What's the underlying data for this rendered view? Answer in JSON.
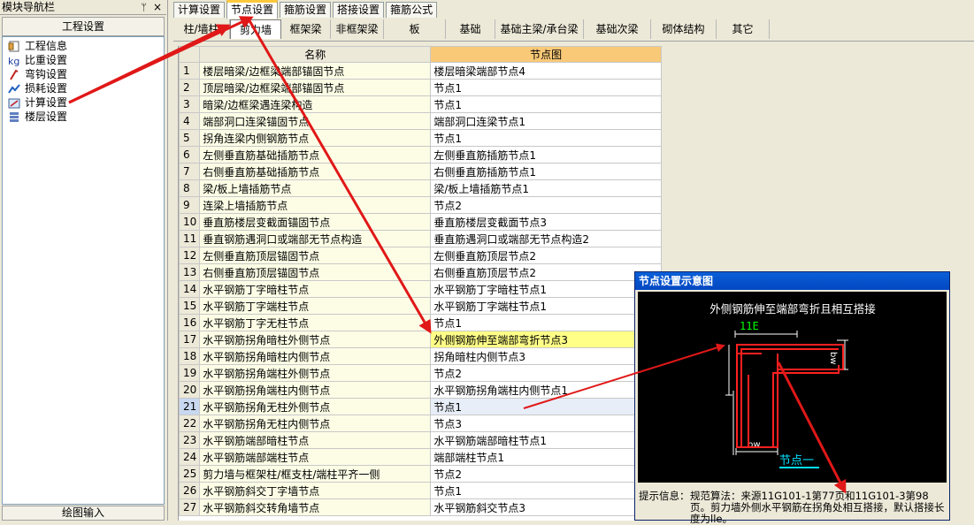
{
  "nav": {
    "title": "模块导航栏",
    "pin": "ᛘ",
    "close": "×",
    "section": "工程设置",
    "items": [
      {
        "label": "工程信息",
        "icon": "document-icon"
      },
      {
        "label": "比重设置",
        "icon": "scale-icon"
      },
      {
        "label": "弯钩设置",
        "icon": "hook-icon"
      },
      {
        "label": "损耗设置",
        "icon": "chart-icon"
      },
      {
        "label": "计算设置",
        "icon": "calc-settings-icon"
      },
      {
        "label": "楼层设置",
        "icon": "floors-icon"
      }
    ],
    "bottom": "绘图输入"
  },
  "tabs": [
    "计算设置",
    "节点设置",
    "箍筋设置",
    "搭接设置",
    "箍筋公式"
  ],
  "active_tab": 1,
  "subtabs": [
    "柱/墙柱",
    "剪力墙",
    "框架梁",
    "非框架梁",
    "板",
    "基础",
    "基础主梁/承台梁",
    "基础次梁",
    "砌体结构",
    "其它"
  ],
  "active_subtab": 1,
  "table": {
    "headers": {
      "name": "名称",
      "detail": "节点图"
    },
    "rows": [
      {
        "n": "1",
        "name": "楼层暗梁/边框梁端部锚固节点",
        "detail": "楼层暗梁端部节点4"
      },
      {
        "n": "2",
        "name": "顶层暗梁/边框梁端部锚固节点",
        "detail": "节点1"
      },
      {
        "n": "3",
        "name": "暗梁/边框梁遇连梁构造",
        "detail": "节点1"
      },
      {
        "n": "4",
        "name": "端部洞口连梁锚固节点",
        "detail": "端部洞口连梁节点1"
      },
      {
        "n": "5",
        "name": "拐角连梁内侧钢筋节点",
        "detail": "节点1"
      },
      {
        "n": "6",
        "name": "左侧垂直筋基础插筋节点",
        "detail": "左侧垂直筋插筋节点1"
      },
      {
        "n": "7",
        "name": "右侧垂直筋基础插筋节点",
        "detail": "右侧垂直筋插筋节点1"
      },
      {
        "n": "8",
        "name": "梁/板上墙插筋节点",
        "detail": "梁/板上墙插筋节点1"
      },
      {
        "n": "9",
        "name": "连梁上墙插筋节点",
        "detail": "节点2"
      },
      {
        "n": "10",
        "name": "垂直筋楼层变截面锚固节点",
        "detail": "垂直筋楼层变截面节点3"
      },
      {
        "n": "11",
        "name": "垂直钢筋遇洞口或端部无节点构造",
        "detail": "垂直筋遇洞口或端部无节点构造2"
      },
      {
        "n": "12",
        "name": "左侧垂直筋顶层锚固节点",
        "detail": "左侧垂直筋顶层节点2"
      },
      {
        "n": "13",
        "name": "右侧垂直筋顶层锚固节点",
        "detail": "右侧垂直筋顶层节点2"
      },
      {
        "n": "14",
        "name": "水平钢筋丁字暗柱节点",
        "detail": "水平钢筋丁字暗柱节点1"
      },
      {
        "n": "15",
        "name": "水平钢筋丁字端柱节点",
        "detail": "水平钢筋丁字端柱节点1"
      },
      {
        "n": "16",
        "name": "水平钢筋丁字无柱节点",
        "detail": "节点1"
      },
      {
        "n": "17",
        "name": "水平钢筋拐角暗柱外侧节点",
        "detail": "外侧钢筋伸至端部弯折节点3"
      },
      {
        "n": "18",
        "name": "水平钢筋拐角暗柱内侧节点",
        "detail": "拐角暗柱内侧节点3"
      },
      {
        "n": "19",
        "name": "水平钢筋拐角端柱外侧节点",
        "detail": "节点2"
      },
      {
        "n": "20",
        "name": "水平钢筋拐角端柱内侧节点",
        "detail": "水平钢筋拐角端柱内侧节点1"
      },
      {
        "n": "21",
        "name": "水平钢筋拐角无柱外侧节点",
        "detail": "节点1"
      },
      {
        "n": "22",
        "name": "水平钢筋拐角无柱内侧节点",
        "detail": "节点3"
      },
      {
        "n": "23",
        "name": "水平钢筋端部暗柱节点",
        "detail": "水平钢筋端部暗柱节点1"
      },
      {
        "n": "24",
        "name": "水平钢筋端部端柱节点",
        "detail": "端部端柱节点1"
      },
      {
        "n": "25",
        "name": "剪力墙与框架柱/框支柱/端柱平齐一侧",
        "detail": "节点2"
      },
      {
        "n": "26",
        "name": "水平钢筋斜交丁字墙节点",
        "detail": "节点1"
      },
      {
        "n": "27",
        "name": "水平钢筋斜交转角墙节点",
        "detail": "水平钢筋斜交节点3"
      }
    ],
    "selected_row": 20,
    "highlighted_row": 16
  },
  "dialog": {
    "title": "节点设置示意图",
    "drawing_title": "外侧钢筋伸至端部弯折且相互搭接",
    "label_lle": "11E",
    "label_bw_right": "bw",
    "label_bw_bottom": "bw",
    "node_label": "节点一",
    "hint_label": "提示信息：",
    "hint_text": "规范算法：来源11G101-1第77页和11G101-3第98页。剪力墙外侧水平钢筋在拐角处相互搭接，默认搭接长度为lle。"
  },
  "colors": {
    "annotation_arrow": "#e01818",
    "rebar": "#ff2020",
    "node_label": "#00e0ff",
    "dim_lines": "#ffffff",
    "lle_label": "#00ff00"
  }
}
